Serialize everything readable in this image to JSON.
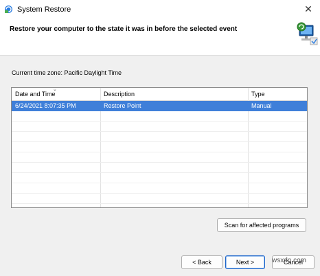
{
  "window": {
    "title": "System Restore",
    "close_glyph": "✕"
  },
  "header": {
    "heading": "Restore your computer to the state it was in before the selected event",
    "icon": "system-restore-computer-icon"
  },
  "timezone_label": "Current time zone: Pacific Daylight Time",
  "restore_list": {
    "columns": [
      "Date and Time",
      "Description",
      "Type"
    ],
    "rows": [
      {
        "date_time": "6/24/2021 8:07:35 PM",
        "description": "Restore Point",
        "type": "Manual",
        "selected": true
      }
    ]
  },
  "buttons": {
    "scan": "Scan for affected programs",
    "back": "< Back",
    "next": "Next >",
    "cancel": "Cancel"
  },
  "watermark": "wsxdn.com",
  "colors": {
    "selection": "#3f7fd9",
    "primary_border": "#1a63c9"
  }
}
